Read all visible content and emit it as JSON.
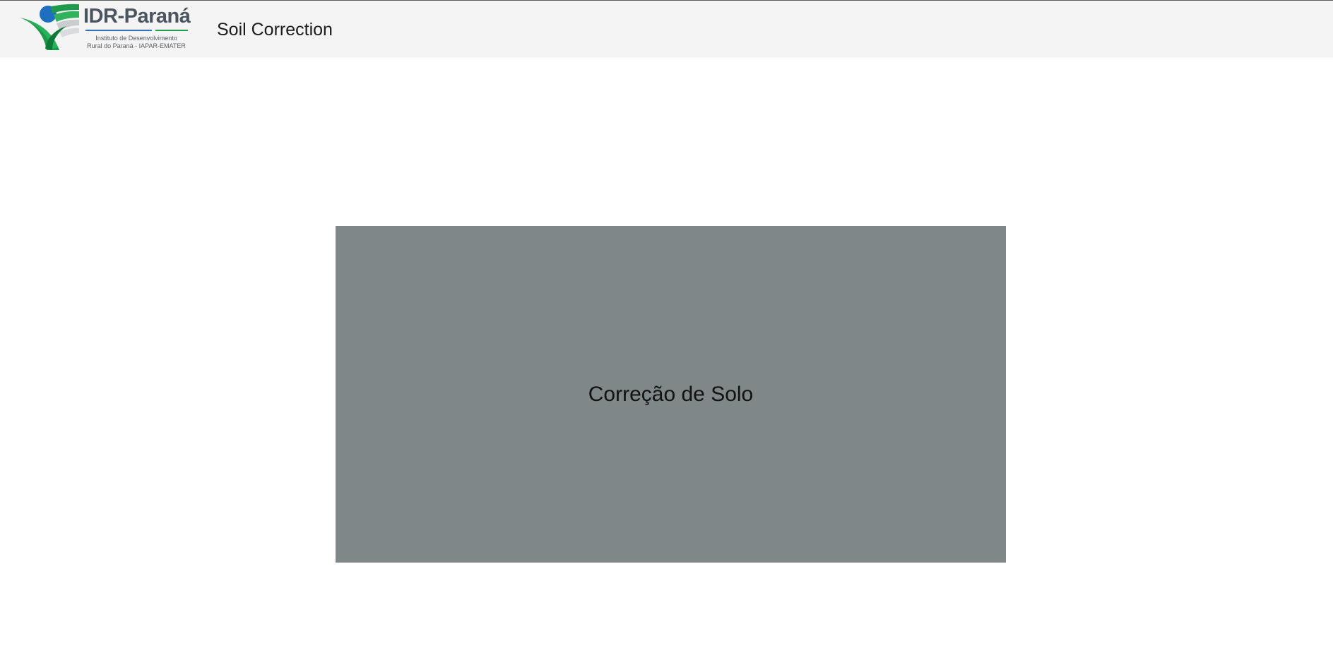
{
  "header": {
    "logo": {
      "name": "IDR-Paraná",
      "subtitle_line1": "Instituto de Desenvolvimento",
      "subtitle_line2": "Rural do Paraná - IAPAR-EMATER",
      "icon": "idr-parana-logo-icon",
      "colors": {
        "wordmark": "#4a5560",
        "blue": "#2e6fb5",
        "green": "#20a04a"
      }
    },
    "title": "Soil Correction",
    "background": "#f4f4f4"
  },
  "main": {
    "card": {
      "label": "Correção de Solo",
      "background": "#7f8788"
    }
  }
}
